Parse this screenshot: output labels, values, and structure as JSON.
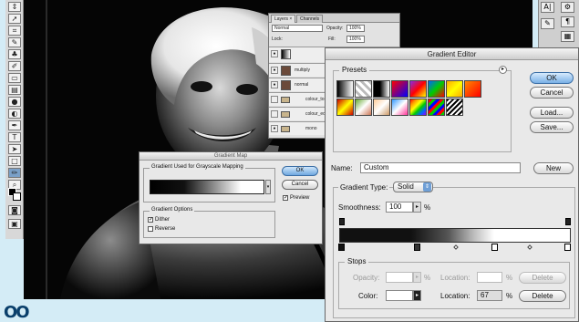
{
  "toolbar": {
    "tools": [
      "move-icon",
      "lasso-icon",
      "crop-icon",
      "brush-icon",
      "stamp-icon",
      "history-brush-icon",
      "eraser-icon",
      "gradient-icon",
      "blur-icon",
      "dodge-icon",
      "pen-icon",
      "type-icon",
      "path-select-icon",
      "shape-icon",
      "notes-icon",
      "eyedropper-icon",
      "hand-icon",
      "zoom-icon"
    ]
  },
  "layers_panel": {
    "tabs": [
      "Layers ×",
      "Channels"
    ],
    "blend_mode": "Normal",
    "opacity_label": "Opacity:",
    "opacity_value": "100%",
    "lock_label": "Lock:",
    "fill_label": "Fill:",
    "fill_value": "100%",
    "layers": [
      {
        "name": "",
        "type": "adjustment"
      },
      {
        "name": "multiply",
        "type": "layer"
      },
      {
        "name": "normal",
        "type": "layer"
      },
      {
        "name": "colour_tone",
        "type": "group"
      },
      {
        "name": "colour_edit",
        "type": "group"
      },
      {
        "name": "mono",
        "type": "group"
      }
    ]
  },
  "gradient_map": {
    "title": "Gradient Map",
    "group_label": "Gradient Used for Grayscale Mapping",
    "ok": "OK",
    "cancel": "Cancel",
    "preview": "Preview",
    "options_label": "Gradient Options",
    "dither": "Dither",
    "reverse": "Reverse",
    "dither_checked": true,
    "reverse_checked": false,
    "preview_checked": true
  },
  "gradient_editor": {
    "title": "Gradient Editor",
    "presets_label": "Presets",
    "ok": "OK",
    "cancel": "Cancel",
    "load": "Load...",
    "save": "Save...",
    "name_label": "Name:",
    "name_value": "Custom",
    "new": "New",
    "type_label": "Gradient Type:",
    "type_value": "Solid",
    "smoothness_label": "Smoothness:",
    "smoothness_value": "100",
    "percent": "%",
    "stops_label": "Stops",
    "opacity_label": "Opacity:",
    "opacity_value": "",
    "location_label": "Location:",
    "opacity_location_value": "",
    "delete": "Delete",
    "color_label": "Color:",
    "color_location_value": "67",
    "color_value": "#ffffff"
  },
  "colors": {
    "background": "#d4ecf6",
    "default_button": "#79b0e6"
  }
}
